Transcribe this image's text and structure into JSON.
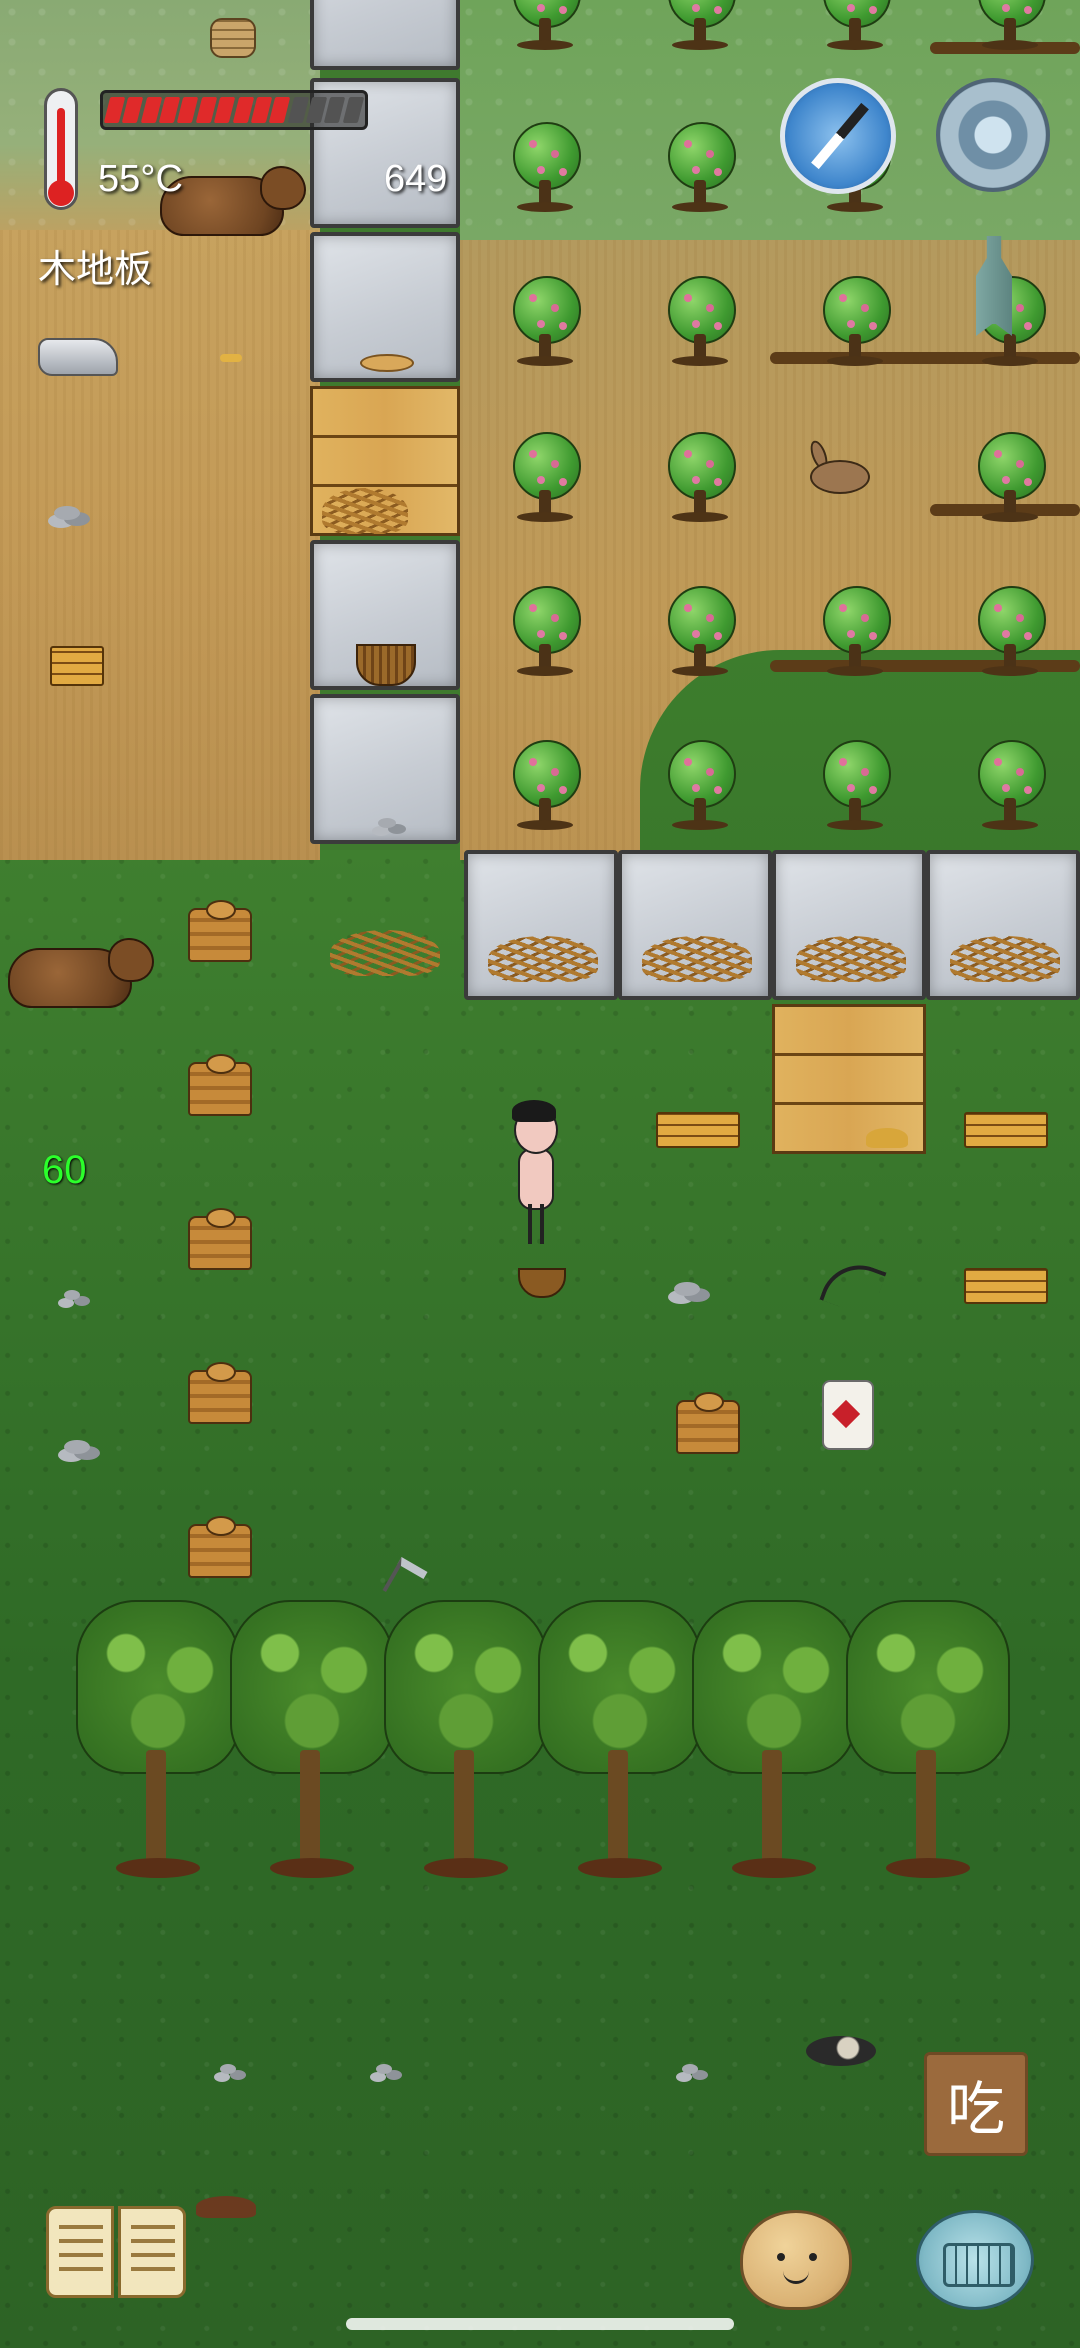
{
  "hud": {
    "temperature": "55°C",
    "tile_name": "木地板",
    "score": "649",
    "hunger": {
      "filled": 10,
      "total": 14
    }
  },
  "debug": {
    "fps": "60"
  },
  "actions": {
    "eat_label": "吃"
  },
  "icons": {
    "thermometer": "thermometer-icon",
    "compass": "compass-icon",
    "settings": "gear-icon",
    "spade": "spade-coin-icon",
    "book": "book-icon",
    "emote": "potato-face-icon",
    "keyboard": "keyboard-chat-icon"
  },
  "colors": {
    "hunger_full": "#e02a2a",
    "hunger_empty": "#535353",
    "fps_text": "#2bff2b",
    "eat_button": "#9b6a3d"
  }
}
